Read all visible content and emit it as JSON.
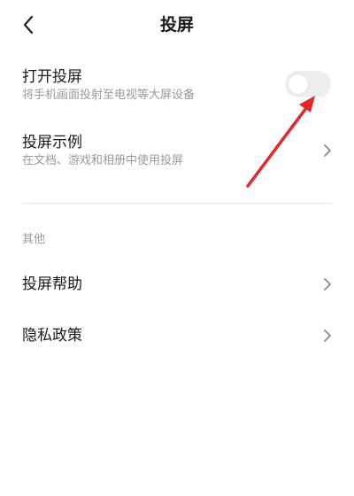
{
  "header": {
    "title": "投屏",
    "back_icon": "chevron-left-icon"
  },
  "cast_toggle": {
    "title": "打开投屏",
    "subtitle": "将手机画面投射至电视等大屏设备",
    "enabled": false
  },
  "cast_examples": {
    "title": "投屏示例",
    "subtitle": "在文档、游戏和相册中使用投屏"
  },
  "other_section": {
    "label": "其他",
    "items": [
      {
        "label": "投屏帮助"
      },
      {
        "label": "隐私政策"
      }
    ]
  },
  "colors": {
    "annotation_arrow": "#e3262a",
    "toggle_off": "#eeeeee"
  }
}
